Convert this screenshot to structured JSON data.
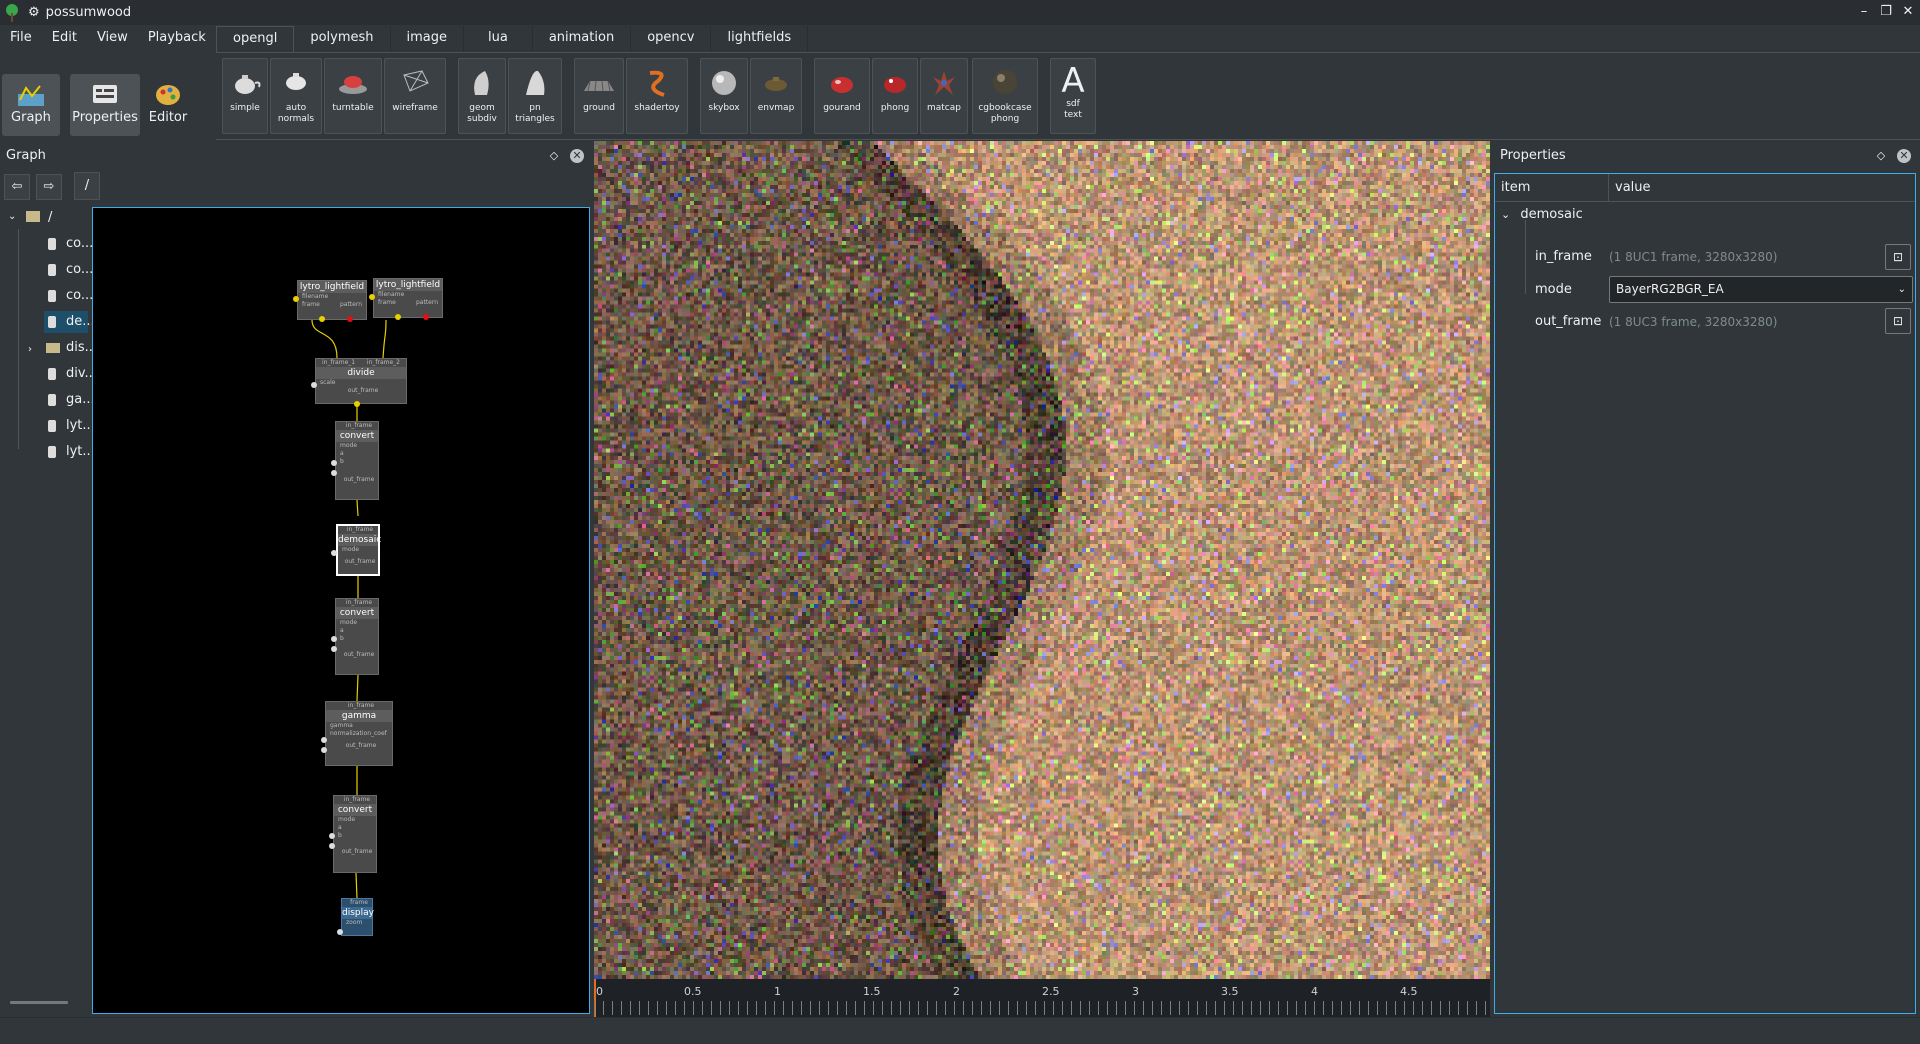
{
  "app": {
    "title": "possumwood"
  },
  "window_controls": {
    "minimize": "–",
    "maximize": "❐",
    "close": "✕"
  },
  "menu": [
    "File",
    "Edit",
    "View",
    "Playback"
  ],
  "modes": [
    {
      "label": "Graph",
      "icon": "graph-icon"
    },
    {
      "label": "Properties",
      "icon": "properties-icon"
    },
    {
      "label": "Editor",
      "icon": "editor-icon"
    }
  ],
  "tabs": [
    "opengl",
    "polymesh",
    "image",
    "lua",
    "animation",
    "opencv",
    "lightfields"
  ],
  "toolbar": [
    {
      "label1": "simple",
      "label2": ""
    },
    {
      "label1": "auto",
      "label2": "normals"
    },
    {
      "label1": "turntable",
      "label2": ""
    },
    {
      "label1": "wireframe",
      "label2": ""
    },
    {
      "label1": "geom",
      "label2": "subdiv"
    },
    {
      "label1": "pn",
      "label2": "triangles"
    },
    {
      "label1": "ground",
      "label2": ""
    },
    {
      "label1": "shadertoy",
      "label2": ""
    },
    {
      "label1": "skybox",
      "label2": ""
    },
    {
      "label1": "envmap",
      "label2": ""
    },
    {
      "label1": "gourand",
      "label2": ""
    },
    {
      "label1": "phong",
      "label2": ""
    },
    {
      "label1": "matcap",
      "label2": ""
    },
    {
      "label1": "cgbookcase",
      "label2": "phong"
    },
    {
      "label1": "sdf",
      "label2": "text",
      "glyph": "A"
    }
  ],
  "graph_panel": {
    "title": "Graph",
    "path": "/",
    "back": "⇦",
    "forward": "⇨",
    "tree_root": "/",
    "tree_items": [
      "co...",
      "co...",
      "co...",
      "de...",
      "dis...",
      "div...",
      "ga...",
      "lyt...",
      "lyt..."
    ]
  },
  "nodes": {
    "lytro1": {
      "title": "lytro_lightfield",
      "p1": "filename",
      "p2a": "frame",
      "p2b": "pattern"
    },
    "lytro2": {
      "title": "lytro_lightfield",
      "p1": "filename",
      "p2a": "frame",
      "p2b": "pattern"
    },
    "divide": {
      "title": "divide",
      "in_a": "in_frame_1",
      "in_b": "in_frame_2",
      "p1": "scale",
      "out": "out_frame"
    },
    "convert1": {
      "title": "convert",
      "in": "in_frame",
      "p1": "mode",
      "p2": "a",
      "p3": "b",
      "out": "out_frame"
    },
    "demosaic": {
      "title": "demosaic",
      "in": "in_frame",
      "p1": "mode",
      "out": "out_frame"
    },
    "convert2": {
      "title": "convert",
      "in": "in_frame",
      "p1": "mode",
      "p2": "a",
      "p3": "b",
      "out": "out_frame"
    },
    "gamma": {
      "title": "gamma",
      "in": "in_frame",
      "p1": "gamma",
      "p2": "normalization_coef",
      "out": "out_frame"
    },
    "convert3": {
      "title": "convert",
      "in": "in_frame",
      "p1": "mode",
      "p2": "a",
      "p3": "b",
      "out": "out_frame"
    },
    "display": {
      "title": "display",
      "in": "frame",
      "p1": "zoom"
    }
  },
  "timeline": {
    "ticks": [
      "0",
      "0.5",
      "1",
      "1.5",
      "2",
      "2.5",
      "3",
      "3.5",
      "4",
      "4.5"
    ]
  },
  "properties_panel": {
    "title": "Properties",
    "col_item": "item",
    "col_value": "value",
    "group": "demosaic",
    "rows": [
      {
        "name": "in_frame",
        "value": "(1 8UC1 frame, 3280x3280)"
      },
      {
        "name": "mode",
        "value": "BayerRG2BGR_EA"
      },
      {
        "name": "out_frame",
        "value": "(1 8UC3 frame, 3280x3280)"
      }
    ]
  },
  "colors": {
    "accent": "#3daee9",
    "background": "#31363b",
    "selected_node": "#ffffff",
    "wire": "#e8d000"
  }
}
